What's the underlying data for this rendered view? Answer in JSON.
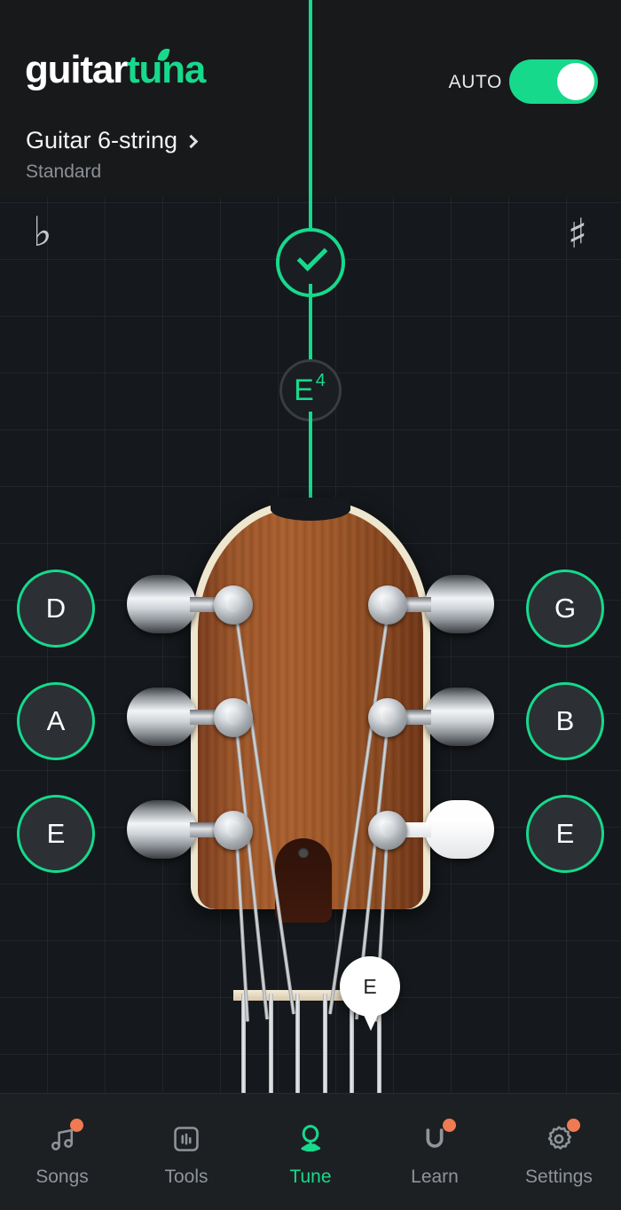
{
  "app": {
    "logo_white": "guitar",
    "logo_green": "tuna",
    "accent_green": "#17d98c",
    "badge_orange": "#f07a52",
    "background": "#15181c"
  },
  "header": {
    "instrument": "Guitar 6-string",
    "tuning_name": "Standard",
    "chevron_icon": "chevron-right-icon",
    "auto_label": "AUTO",
    "auto_enabled": true
  },
  "tuner": {
    "flat_symbol": "♭",
    "sharp_symbol": "♯",
    "in_tune": true,
    "check_icon": "check-icon",
    "detected_note": "E",
    "detected_octave": "4",
    "needle_position": "center"
  },
  "strings": {
    "left": [
      {
        "label": "D",
        "name": "string-button-d"
      },
      {
        "label": "A",
        "name": "string-button-a"
      },
      {
        "label": "E",
        "name": "string-button-e-low"
      }
    ],
    "right": [
      {
        "label": "G",
        "name": "string-button-g"
      },
      {
        "label": "B",
        "name": "string-button-b"
      },
      {
        "label": "E",
        "name": "string-button-e-high"
      }
    ]
  },
  "active_string": {
    "label": "E",
    "peg": "bottom-right"
  },
  "nav": {
    "items": [
      {
        "label": "Songs",
        "icon": "music-note-icon",
        "active": false,
        "badge": true
      },
      {
        "label": "Tools",
        "icon": "tools-icon",
        "active": false,
        "badge": false
      },
      {
        "label": "Tune",
        "icon": "tuning-peg-icon",
        "active": true,
        "badge": false
      },
      {
        "label": "Learn",
        "icon": "learn-icon",
        "active": false,
        "badge": true
      },
      {
        "label": "Settings",
        "icon": "gear-icon",
        "active": false,
        "badge": true
      }
    ]
  }
}
